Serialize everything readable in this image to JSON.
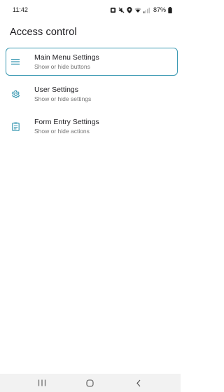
{
  "status_bar": {
    "time": "11:42",
    "battery": "87%"
  },
  "app_bar": {
    "title": "Access control"
  },
  "settings": [
    {
      "title": "Main Menu Settings",
      "subtitle": "Show or hide buttons",
      "icon": "menu-icon"
    },
    {
      "title": "User Settings",
      "subtitle": "Show or hide settings",
      "icon": "gear-icon"
    },
    {
      "title": "Form Entry Settings",
      "subtitle": "Show or hide actions",
      "icon": "clipboard-icon"
    }
  ],
  "colors": {
    "accent": "#3c9ab3",
    "focus_border": "#3c9ab3"
  }
}
